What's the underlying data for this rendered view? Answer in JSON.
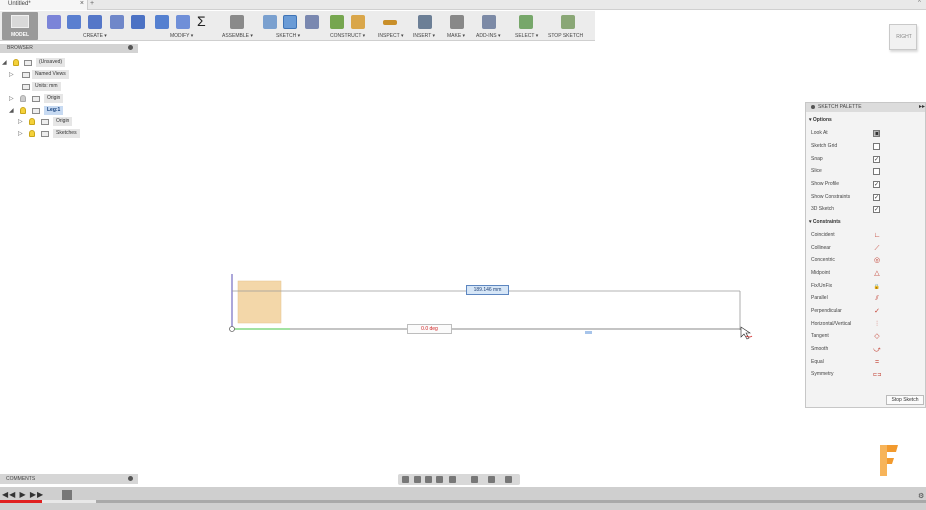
{
  "tab": {
    "title": "Untitled*",
    "close": "×",
    "new_tab": "+"
  },
  "window": {
    "collapse": "^"
  },
  "toolbar": {
    "workspace": "MODEL",
    "groups": [
      {
        "label": "CREATE ▾"
      },
      {
        "label": "MODIFY ▾"
      },
      {
        "label": "ASSEMBLE ▾"
      },
      {
        "label": "SKETCH ▾"
      },
      {
        "label": "CONSTRUCT ▾"
      },
      {
        "label": "INSPECT ▾"
      },
      {
        "label": "INSERT ▾"
      },
      {
        "label": "MAKE ▾"
      },
      {
        "label": "ADD-INS ▾"
      },
      {
        "label": "SELECT ▾"
      },
      {
        "label": "STOP SKETCH"
      }
    ],
    "sigma_glyph": "Σ"
  },
  "browser": {
    "title": "BROWSER",
    "items": [
      {
        "label": "(Unsaved)"
      },
      {
        "label": "Named Views"
      },
      {
        "label": "Units: mm"
      },
      {
        "label": "Origin"
      },
      {
        "label": "Leg:1"
      },
      {
        "label": "Origin"
      },
      {
        "label": "Sketches"
      }
    ]
  },
  "canvas": {
    "dimension_label": "189.146 mm",
    "angle_label": "0.0 deg"
  },
  "viewcube": {
    "face": "RIGHT"
  },
  "palette": {
    "title": "SKETCH PALETTE",
    "expand": "▸▸",
    "options_title": "▾ Options",
    "options": [
      {
        "label": "Look At",
        "state": "▣"
      },
      {
        "label": "Sketch Grid",
        "state": ""
      },
      {
        "label": "Snap",
        "state": "✓"
      },
      {
        "label": "Slice",
        "state": ""
      },
      {
        "label": "Show Profile",
        "state": "✓"
      },
      {
        "label": "Show Constraints",
        "state": "✓"
      },
      {
        "label": "3D Sketch",
        "state": "✓"
      }
    ],
    "constraints_title": "▾ Constraints",
    "constraints": [
      {
        "label": "Coincident",
        "icon": "∟"
      },
      {
        "label": "Collinear",
        "icon": "⟋"
      },
      {
        "label": "Concentric",
        "icon": "◎"
      },
      {
        "label": "Midpoint",
        "icon": "△"
      },
      {
        "label": "Fix/UnFix",
        "icon": "🔒"
      },
      {
        "label": "Parallel",
        "icon": "⫽"
      },
      {
        "label": "Perpendicular",
        "icon": "✓"
      },
      {
        "label": "Horizontal/Vertical",
        "icon": "⫶"
      },
      {
        "label": "Tangent",
        "icon": "◇"
      },
      {
        "label": "Smooth",
        "icon": "⤻"
      },
      {
        "label": "Equal",
        "icon": "="
      },
      {
        "label": "Symmetry",
        "icon": "⊏⊐"
      }
    ],
    "stop_button": "Stop Sketch"
  },
  "comments": {
    "title": "COMMENTS"
  },
  "video": {
    "controls": "◀◀ ▶ ▶▶",
    "played_fraction": 0.045
  },
  "colors": {
    "accent": "#6a9bd6",
    "sketch_line": "#9a9a9a",
    "profile_fill": "#f3d7a9",
    "dimension_box": "#d6e6f7",
    "angle_text": "#d02020"
  }
}
